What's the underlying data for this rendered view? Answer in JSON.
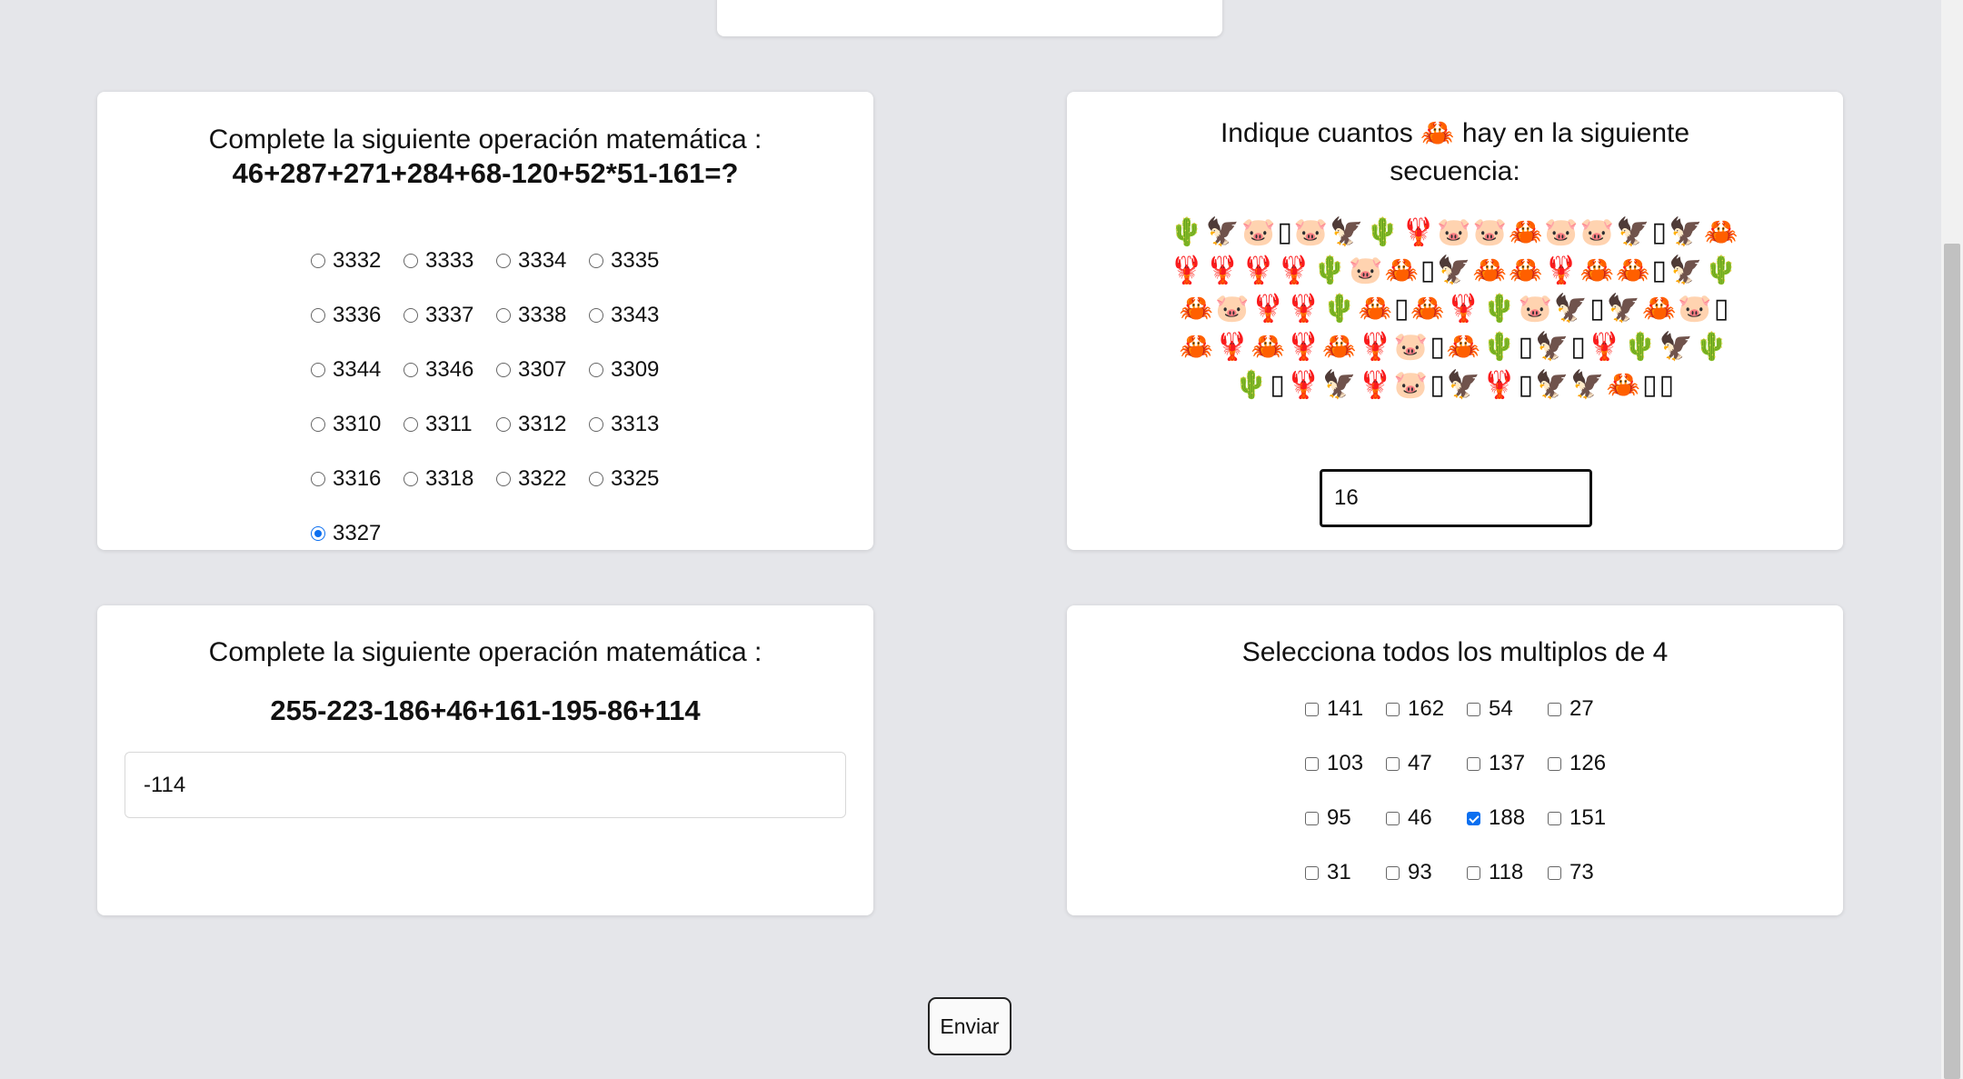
{
  "question1": {
    "prompt": "Complete la siguiente operación matemática :",
    "expression": "46+287+271+284+68-120+52*51-161=?",
    "options": [
      "3332",
      "3333",
      "3334",
      "3335",
      "3336",
      "3337",
      "3338",
      "3343",
      "3344",
      "3346",
      "3307",
      "3309",
      "3310",
      "3311",
      "3312",
      "3313",
      "3316",
      "3318",
      "3322",
      "3325",
      "3327"
    ],
    "selected": "3327"
  },
  "question2": {
    "prompt_before": "Indique cuantos",
    "target_emoji": "🦀",
    "prompt_after": "hay en la siguiente secuencia:",
    "sequence": "🌵🦅🐷▯🐷🦅🌵🦞🐷🐷🦀🐷🐷🦅▯🦅🦀🦞🦞🦞🦞🌵🐷🦀▯🦅🦀🦀🦞🦀🦀▯🦅🌵🦀🐷🦞🦞🌵🦀▯🦀🦞🌵🐷🦅▯🦅🦀🐷▯🦀🦞🦀🦞🦀🦞🐷▯🦀🌵▯🦅▯🦞🌵🦅🌵🌵▯🦞🦅🦞🐷▯🦅🦞▯🦅🦅🦀▯▯",
    "answer_value": "16"
  },
  "question3": {
    "prompt": "Complete la siguiente operación matemática :",
    "expression": "255-223-186+46+161-195-86+114",
    "answer_value": "-114"
  },
  "question4": {
    "prompt": "Selecciona todos los multiplos de 4",
    "options": [
      "141",
      "162",
      "54",
      "27",
      "103",
      "47",
      "137",
      "126",
      "95",
      "46",
      "188",
      "151",
      "31",
      "93",
      "118",
      "73"
    ],
    "checked": [
      "188"
    ]
  },
  "submit_label": "Enviar",
  "colors": {
    "accent": "#0b6ff0",
    "background": "#e5e6ea",
    "card": "#ffffff"
  }
}
